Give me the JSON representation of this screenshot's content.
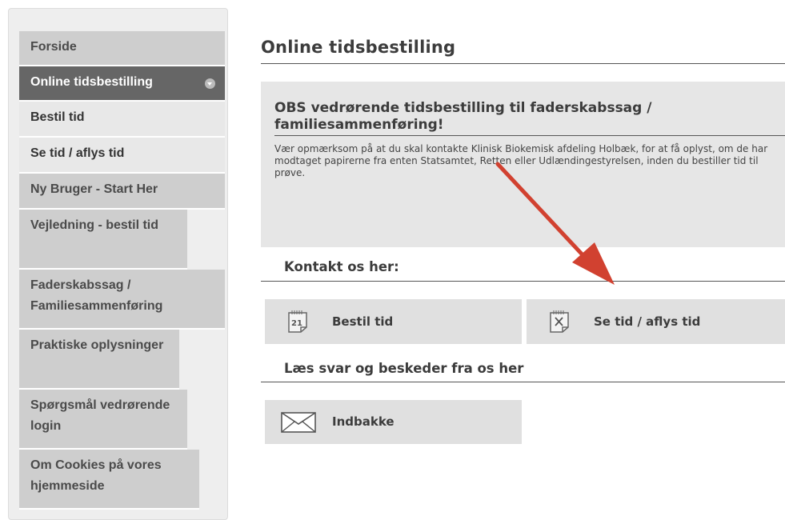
{
  "sidebar": {
    "items": [
      {
        "label": "Forside",
        "state": "normal"
      },
      {
        "label": "Online tidsbestilling",
        "state": "active"
      },
      {
        "label": "Bestil tid",
        "state": "sub"
      },
      {
        "label": "Se tid / aflys tid",
        "state": "sub"
      },
      {
        "label": "Ny Bruger - Start Her",
        "state": "normal"
      },
      {
        "label": "Vejledning - bestil tid",
        "state": "normal"
      },
      {
        "label": "Faderskabssag / Familiesammenføring",
        "state": "normal"
      },
      {
        "label": "Praktiske oplysninger",
        "state": "normal"
      },
      {
        "label": "Spørgsmål vedrørende login",
        "state": "normal"
      },
      {
        "label": "Om Cookies på vores hjemmeside",
        "state": "normal"
      }
    ]
  },
  "main": {
    "title": "Online tidsbestilling",
    "notice": {
      "title": "OBS vedrørende tidsbestilling til faderskabssag / familiesammenføring!",
      "text": "Vær opmærksom på at du skal kontakte Klinisk Biokemisk afdeling Holbæk, for at få oplyst, om de har modtaget papirerne fra enten Statsamtet, Retten eller Udlændingestyrelsen, inden du bestiller tid til prøve."
    },
    "contact_heading": "Kontakt os her:",
    "buttons": {
      "book": "Bestil tid",
      "view_cancel": "Se tid / aflys tid",
      "inbox": "Indbakke"
    },
    "messages_heading": "Læs svar og beskeder fra os her",
    "calendar_icon_day": "21"
  },
  "colors": {
    "active_menu": "#666666",
    "menu": "#cecece",
    "sub_menu": "#e8e8e8",
    "arrow": "#d14130"
  },
  "icons": [
    "calendar-icon",
    "cancel-calendar-icon",
    "envelope-icon",
    "chevron-down-icon"
  ]
}
